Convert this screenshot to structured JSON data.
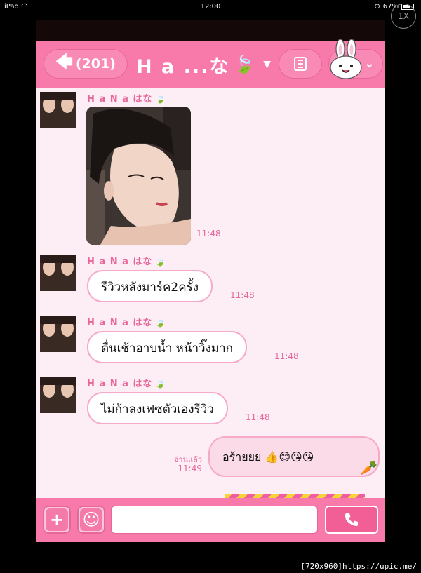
{
  "status_bar": {
    "device": "iPad",
    "time": "12:00",
    "battery": "67%"
  },
  "zoom_label": "1X",
  "header": {
    "back_count": "(201)",
    "title": "H a ...な"
  },
  "messages": [
    {
      "sender": "H a N a  はな",
      "type": "image",
      "time": "11:48"
    },
    {
      "sender": "H a N a  はな",
      "type": "text",
      "text": "รีวิวหลังมาร์ค2ครั้ง",
      "time": "11:48"
    },
    {
      "sender": "H a N a  はな",
      "type": "text",
      "text": "ตื่นเช้าอาบน้ำ หน้าวิ๊งมาก",
      "time": "11:48"
    },
    {
      "sender": "H a N a  はな",
      "type": "text",
      "text": "ไม่ก้าลงเฟซตัวเองรีวิว",
      "time": "11:48"
    }
  ],
  "outgoing": {
    "text": "อร้ายยย 👍😊😘😘",
    "read_label": "อ่านแล้ว",
    "time": "11:49"
  },
  "input": {
    "placeholder": ""
  },
  "watermark": "[720x960]https://upic.me/",
  "colors": {
    "header": "#f87aab",
    "chat_bg": "#fdeef6",
    "accent": "#e8669a"
  }
}
